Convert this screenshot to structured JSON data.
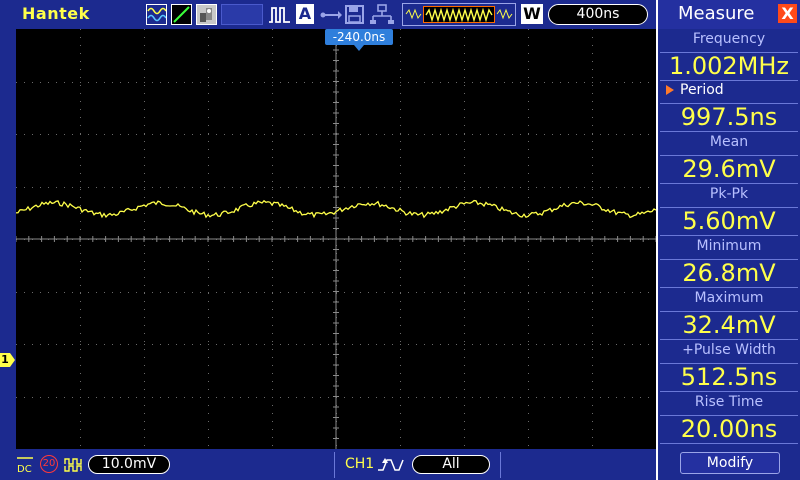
{
  "header": {
    "brand": "Hantek",
    "auto_label": "A",
    "wave_mode_label": "W",
    "timebase": "400ns"
  },
  "screen": {
    "trigger_position": "-240.0ns",
    "channel_marker": "1",
    "trace_color": "#ffff4a"
  },
  "footer": {
    "bandwidth_limit": "20",
    "volts_per_div": "10.0mV",
    "trigger_channel": "CH1",
    "trigger_source": "All"
  },
  "measure": {
    "title": "Measure",
    "close_label": "X",
    "items": [
      {
        "label": "Frequency",
        "value": "1.002MHz"
      },
      {
        "label": "Period",
        "value": "997.5ns",
        "selected": true
      },
      {
        "label": "Mean",
        "value": "29.6mV"
      },
      {
        "label": "Pk-Pk",
        "value": "5.60mV"
      },
      {
        "label": "Minimum",
        "value": "26.8mV"
      },
      {
        "label": "Maximum",
        "value": "32.4mV"
      },
      {
        "label": "+Pulse Width",
        "value": "512.5ns"
      },
      {
        "label": "Rise Time",
        "value": "20.00ns"
      }
    ],
    "modify_label": "Modify"
  },
  "icons": {
    "trigger_mode": "waveform-icon",
    "slope": "slope-icon",
    "persistence": "dots-icon",
    "pulse": "pulse-icon",
    "usb": "usb-icon",
    "save": "save-icon",
    "network": "network-icon",
    "coupling": "dc-coupling-icon",
    "invert": "invert-icon",
    "trigger_edge": "trigger-edge-icon"
  }
}
